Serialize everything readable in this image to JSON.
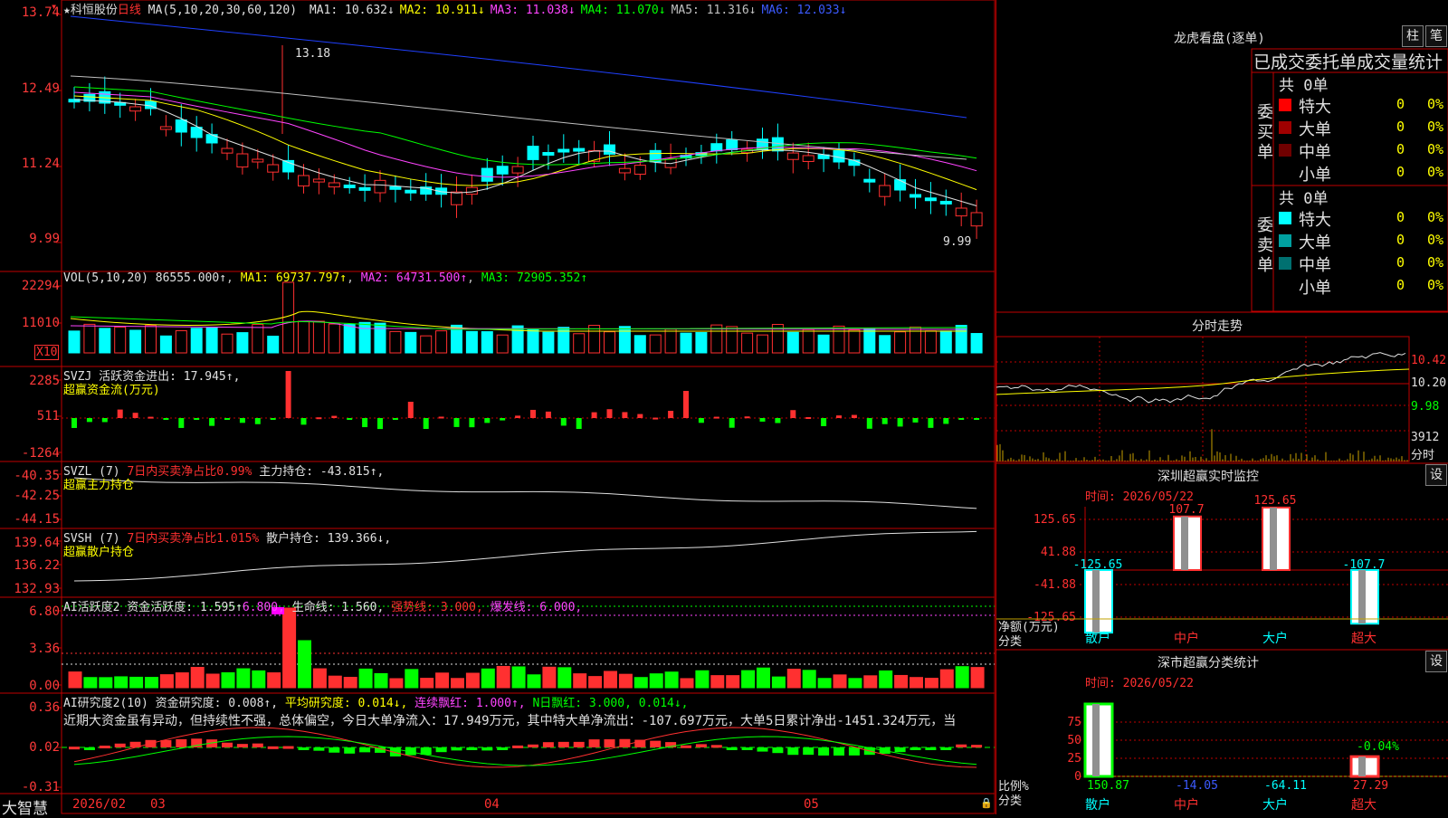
{
  "stock": {
    "name": "★科恒股份",
    "period": "日线",
    "ma_label": "MA(5,10,20,30,60,120)",
    "ma": [
      {
        "t": "MA1: 10.632↓",
        "c": "#e0e0e0"
      },
      {
        "t": "MA2: 10.911↓",
        "c": "#ffff00"
      },
      {
        "t": "MA3: 11.038↓",
        "c": "#ff44ff"
      },
      {
        "t": "MA4: 11.070↓",
        "c": "#00ff00"
      },
      {
        "t": "MA5: 11.316↓",
        "c": "#c0c0c0"
      },
      {
        "t": "MA6: 12.033↓",
        "c": "#3c5aff"
      }
    ],
    "high_label": "13.18",
    "low_label": "9.99",
    "y_ticks": [
      "13.74",
      "12.49",
      "11.24",
      "9.99"
    ]
  },
  "vol": {
    "title": "VOL(5,10,20)",
    "value": "86555.000↑",
    "ma1": "MA1: 69737.797↑",
    "ma2": "MA2: 64731.500↑",
    "ma3": "MA3: 72905.352↑",
    "y_ticks": [
      "22294",
      "11010"
    ],
    "unit": "X10"
  },
  "svzj": {
    "title": "SVZJ  活跃资金进出: 17.945↑,",
    "sub": "超赢资金流(万元)",
    "y_ticks": [
      "2285",
      "511",
      "-1264"
    ]
  },
  "svzl": {
    "title": "SVZL (7)",
    "pct": "7日内买卖净占比0.99%",
    "main": "主力持仓: -43.815↑,",
    "sub": "超赢主力持仓",
    "y_ticks": [
      "-40.35",
      "-42.25",
      "-44.15"
    ]
  },
  "svsh": {
    "title": "SVSH (7)",
    "pct": "7日内买卖净占比1.015%",
    "retail": "散户持仓: 139.366↓,",
    "sub": "超赢散户持仓",
    "y_ticks": [
      "139.64",
      "136.22",
      "132.93"
    ]
  },
  "ai1": {
    "title": "AI活跃度2 资金活跃度: 1.595↑",
    "v2": "6.800,",
    "life": "生命线: 1.560,",
    "strong": "强势线: 3.000,",
    "burst": "爆发线: 6.000,",
    "y_ticks": [
      "6.80",
      "3.36",
      "0.00"
    ]
  },
  "ai2": {
    "title": "AI研究度2(10) 资金研究度: 0.008↑,",
    "avg": "平均研究度: 0.014↓,",
    "lx": "连续飘红: 1.000↑,",
    "nr": "N日飘红: 3.000, 0.014↓,",
    "desc": "近期大资金虽有异动，但持续性不强，总体偏空，今日大单净流入：17.949万元，其中特大单净流出：-107.697万元，大单5日累计净出-1451.324万元，当",
    "y_ticks": [
      "0.36",
      "0.02",
      "-0.31"
    ]
  },
  "dates": {
    "brand": "大智慧",
    "d1": "2026/02",
    "d2": "03",
    "d3": "04",
    "d4": "05"
  },
  "lhb": {
    "title": "龙虎看盘(逐单)",
    "btn1": "柱",
    "btn2": "笔",
    "header": "已成交委托单成交量统计",
    "buy": {
      "label": [
        "委",
        "买",
        "单"
      ],
      "total": "共 0单",
      "rows": [
        {
          "n": "特大",
          "c": "#ff0000",
          "v": "0",
          "p": "0%"
        },
        {
          "n": "大单",
          "c": "#a00000",
          "v": "0",
          "p": "0%"
        },
        {
          "n": "中单",
          "c": "#700000",
          "v": "0",
          "p": "0%"
        },
        {
          "n": "小单",
          "c": "",
          "v": "0",
          "p": "0%"
        }
      ]
    },
    "sell": {
      "label": [
        "委",
        "卖",
        "单"
      ],
      "total": "共 0单",
      "rows": [
        {
          "n": "特大",
          "c": "#00ffff",
          "v": "0",
          "p": "0%"
        },
        {
          "n": "大单",
          "c": "#00a0a0",
          "v": "0",
          "p": "0%"
        },
        {
          "n": "中单",
          "c": "#007070",
          "v": "0",
          "p": "0%"
        },
        {
          "n": "小单",
          "c": "",
          "v": "0",
          "p": "0%"
        }
      ]
    }
  },
  "intraday": {
    "title": "分时走势",
    "y_ticks": [
      "10.42",
      "10.20",
      "9.98"
    ],
    "vol_tick": "3912",
    "vol_label": "分时"
  },
  "sz_monitor": {
    "title": "深圳超赢实时监控",
    "btn": "设",
    "time": "时间: 2026/05/22",
    "y_ticks": [
      "125.65",
      "41.88",
      "-41.88",
      "-125.65"
    ],
    "ylabel1": "净额(万元)",
    "ylabel2": "分类",
    "categories": [
      "散户",
      "中户",
      "大户",
      "超大"
    ],
    "values": [
      -125.65,
      107.7,
      125.65,
      -107.7
    ],
    "labels": [
      "-125.65",
      "107.7",
      "125.65",
      "-107.7"
    ]
  },
  "sz_class": {
    "title": "深市超赢分类统计",
    "btn": "设",
    "time": "时间: 2026/05/22",
    "y_ticks": [
      "75",
      "50",
      "25",
      "0"
    ],
    "ylabel1": "比例%",
    "ylabel2": "分类",
    "categories": [
      "散户",
      "中户",
      "大户",
      "超大"
    ],
    "values": [
      150.87,
      -14.05,
      -64.11,
      27.29
    ],
    "labels": [
      "150.87",
      "-14.05",
      "-64.11",
      "27.29"
    ],
    "extra": "-0.04%"
  },
  "colors": {
    "up": "#ff3030",
    "down": "#00ffff",
    "grid": "#c00000"
  }
}
